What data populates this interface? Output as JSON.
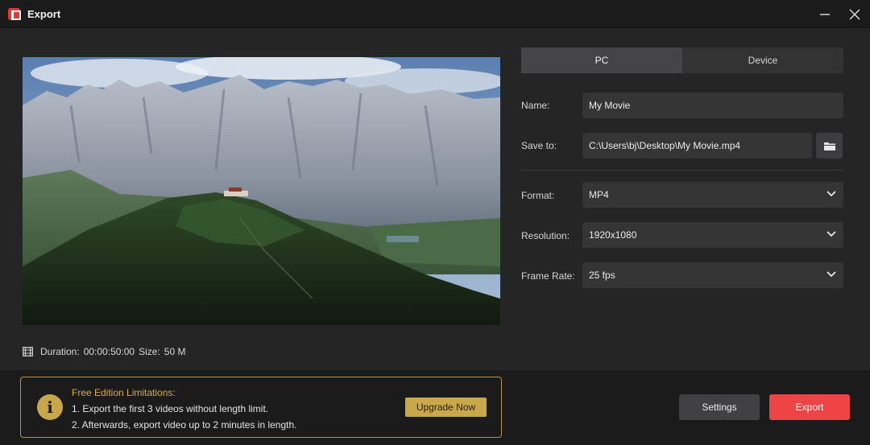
{
  "window": {
    "title": "Export",
    "icon": "app-logo-icon",
    "controls": [
      "minimize-icon",
      "close-icon"
    ]
  },
  "preview": {
    "image": "mountain-landscape-thumbnail",
    "duration_label": "Duration:",
    "duration_value": "00:00:50:00",
    "size_label": "Size:",
    "size_value": "50 M"
  },
  "tabs": [
    {
      "label": "PC",
      "active": true
    },
    {
      "label": "Device",
      "active": false
    }
  ],
  "fields": {
    "name": {
      "label": "Name:",
      "value": "My Movie"
    },
    "save_to": {
      "label": "Save to:",
      "value": "C:\\Users\\bj\\Desktop\\My Movie.mp4"
    },
    "format": {
      "label": "Format:",
      "value": "MP4"
    },
    "resolution": {
      "label": "Resolution:",
      "value": "1920x1080"
    },
    "frame_rate": {
      "label": "Frame Rate:",
      "value": "25 fps"
    }
  },
  "notice": {
    "title": "Free Edition Limitations:",
    "line1": "1. Export the first 3 videos without length limit.",
    "line2": "2. Afterwards, export video up to 2 minutes in length.",
    "upgrade_label": "Upgrade Now"
  },
  "actions": {
    "settings_label": "Settings",
    "export_label": "Export"
  },
  "colors": {
    "accent_export": "#ee4446",
    "gold": "#c9a74b",
    "notice_title": "#d9ad3f"
  }
}
